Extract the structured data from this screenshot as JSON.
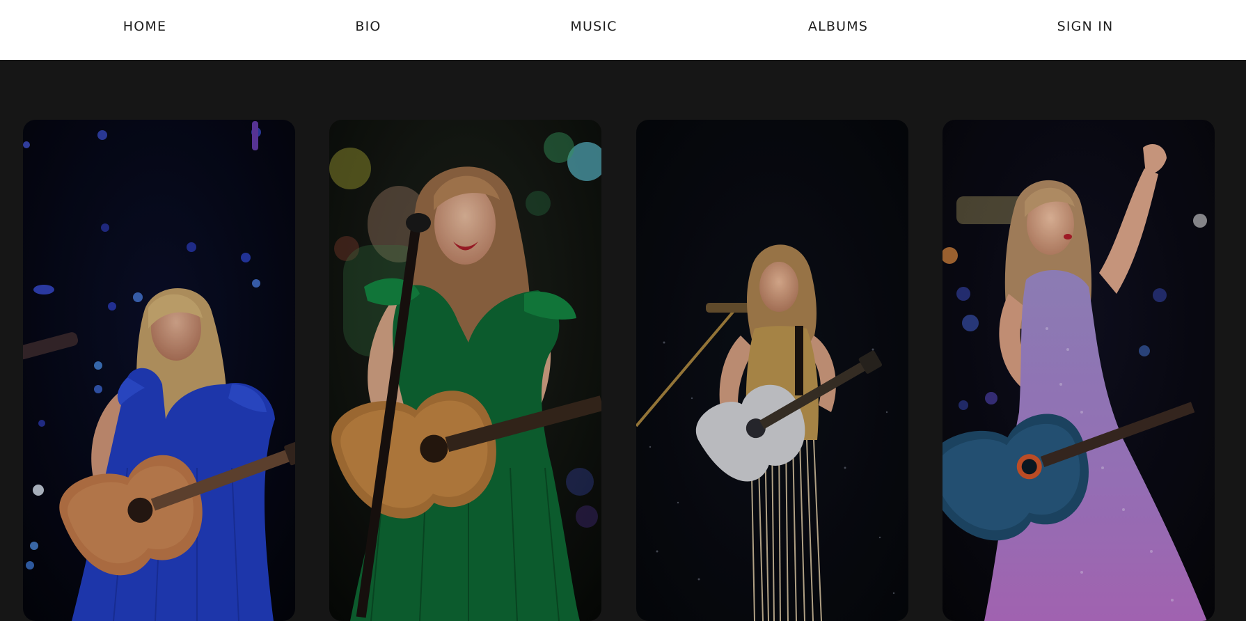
{
  "nav": {
    "items": [
      {
        "label": "HOME"
      },
      {
        "label": "BIO"
      },
      {
        "label": "MUSIC"
      },
      {
        "label": "ALBUMS"
      },
      {
        "label": "SIGN IN"
      }
    ]
  },
  "gallery": {
    "photos": [
      {
        "subject": "performer in blue dress playing acoustic guitar",
        "dress_color": "#2340c8"
      },
      {
        "subject": "performer in green dress singing at microphone with guitar",
        "dress_color": "#0f6b35"
      },
      {
        "subject": "performer in gold fringe outfit with sparkly guitar",
        "dress_color": "#b8924d"
      },
      {
        "subject": "performer in lavender sequin dress waving with guitar",
        "dress_color": "#9b7fc4"
      }
    ]
  },
  "colors": {
    "page_background": "#161616",
    "nav_background": "#ffffff",
    "nav_text": "#1f1f1f"
  }
}
